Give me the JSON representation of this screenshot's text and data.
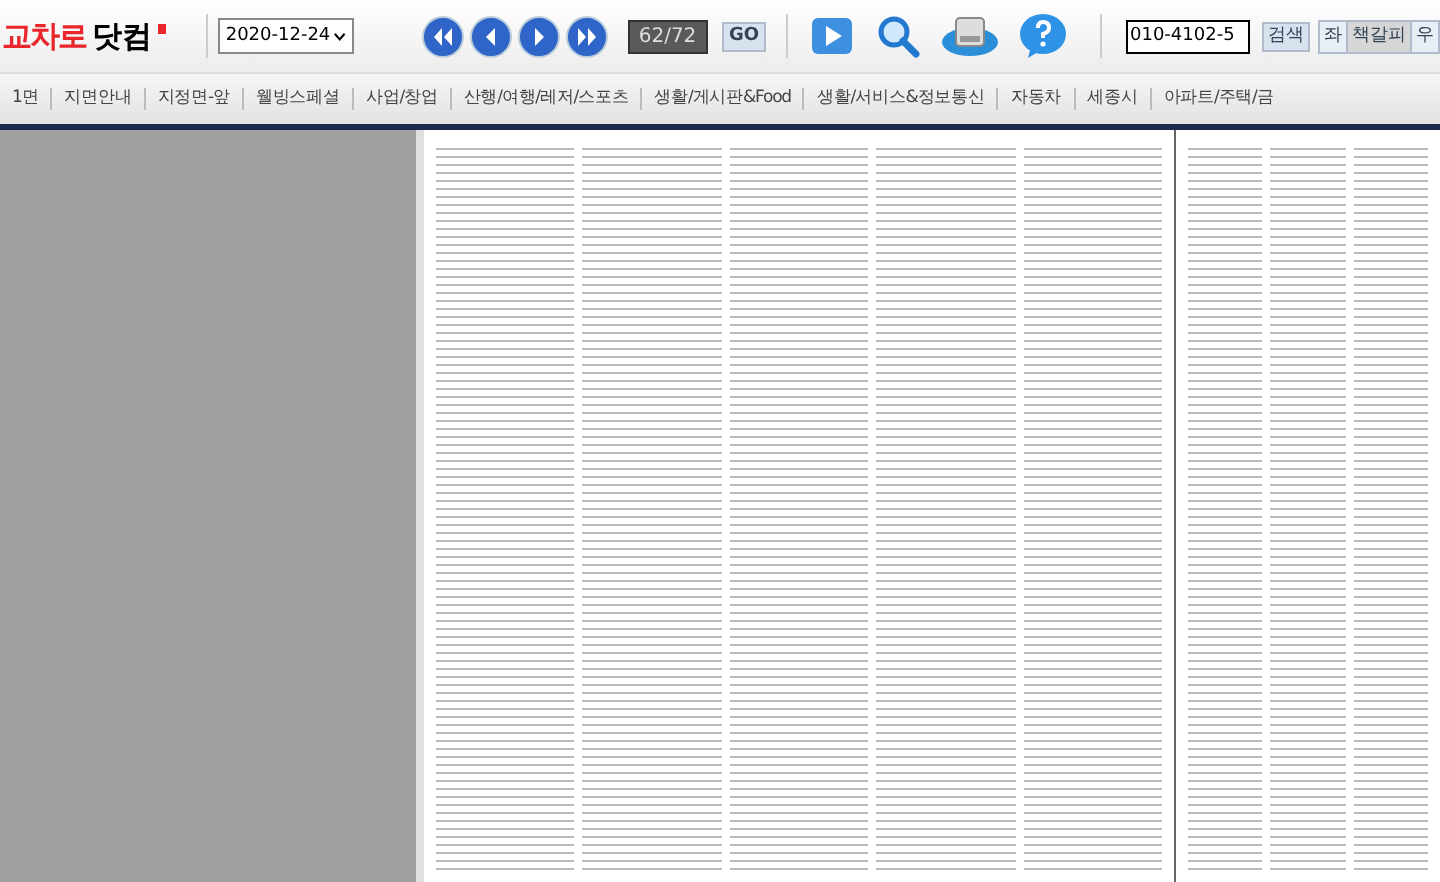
{
  "header": {
    "logo_main": "교차로",
    "logo_sub": "닷컴",
    "date": "2020-12-24",
    "page_counter": "62/72",
    "go_button": "GO",
    "search_value": "010-4102-5",
    "search_button": "검색",
    "left_button": "좌",
    "bookmark_button": "책갈피",
    "right_button": "우"
  },
  "nav": [
    {
      "label": "1면"
    },
    {
      "label": "지면안내"
    },
    {
      "label": "지정면-앞"
    },
    {
      "label": "웰빙스페셜"
    },
    {
      "label": "사업/창업"
    },
    {
      "label": "산행/여행/레저/스포츠"
    },
    {
      "label": "생활/게시판&Food"
    },
    {
      "label": "생활/서비스&정보통신"
    },
    {
      "label": "자동차"
    },
    {
      "label": "세종시"
    },
    {
      "label": "아파트/주택/금"
    }
  ]
}
